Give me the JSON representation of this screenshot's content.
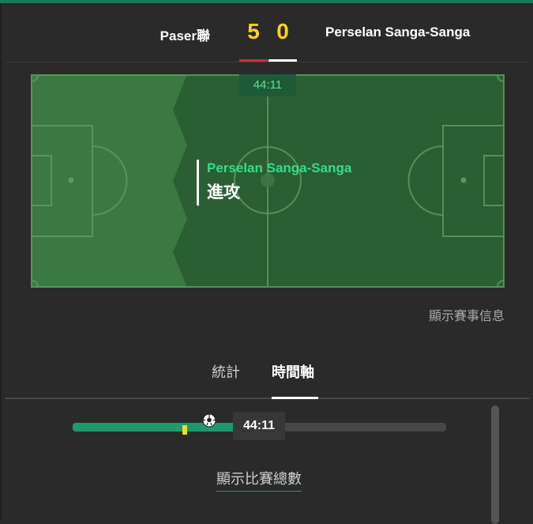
{
  "match": {
    "home_team": "Paser聯",
    "away_team": "Perselan Sanga-Sanga",
    "home_score": "5",
    "away_score": "0",
    "home_color": "#d12b36",
    "away_color": "#ffffff"
  },
  "pitch": {
    "clock": "44:11",
    "event_team": "Perselan Sanga-Sanga",
    "event_action": "進攻",
    "attacking_side": "right"
  },
  "links": {
    "show_match_info": "顯示賽事信息",
    "show_match_total": "顯示比賽總數"
  },
  "tabs": [
    {
      "label": "統計",
      "active": false
    },
    {
      "label": "時間軸",
      "active": true
    }
  ],
  "timeline": {
    "clock": "44:11",
    "progress_percent": 49,
    "events": [
      {
        "type": "yellow-card",
        "icon": "yellow-card-icon",
        "minute": 27
      },
      {
        "type": "goal",
        "icon": "football-icon",
        "minute": 33
      },
      {
        "type": "goal",
        "icon": "football-icon",
        "minute": 41
      }
    ]
  },
  "colors": {
    "accent": "#1c9a6c",
    "score": "#ffd21a",
    "event_team": "#2fe08a",
    "pitch_light": "#3a7a40",
    "pitch_dark": "#2b5e33"
  }
}
